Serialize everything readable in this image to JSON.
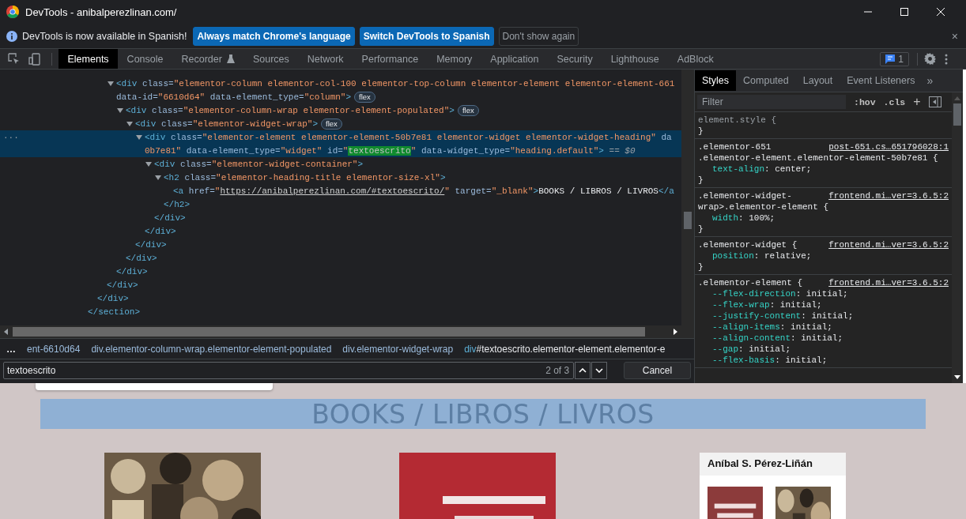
{
  "window": {
    "title": "DevTools - anibalperezlinan.com/"
  },
  "infobar": {
    "message": "DevTools is now available in Spanish!",
    "buttons": [
      {
        "label": "Always match Chrome's language",
        "kind": "primary"
      },
      {
        "label": "Switch DevTools to Spanish",
        "kind": "primary"
      },
      {
        "label": "Don't show again",
        "kind": "outline"
      }
    ],
    "close": "×"
  },
  "toolbar": {
    "tabs": [
      {
        "label": "Elements",
        "selected": true,
        "kind": "stable"
      },
      {
        "label": "Console",
        "selected": false,
        "kind": "stable"
      },
      {
        "label": "Recorder",
        "selected": false,
        "kind": "experimental"
      },
      {
        "label": "Sources",
        "selected": false,
        "kind": "stable"
      },
      {
        "label": "Network",
        "selected": false,
        "kind": "stable"
      },
      {
        "label": "Performance",
        "selected": false,
        "kind": "stable"
      },
      {
        "label": "Memory",
        "selected": false,
        "kind": "stable"
      },
      {
        "label": "Application",
        "selected": false,
        "kind": "stable"
      },
      {
        "label": "Security",
        "selected": false,
        "kind": "stable"
      },
      {
        "label": "Lighthouse",
        "selected": false,
        "kind": "stable"
      },
      {
        "label": "AdBlock",
        "selected": false,
        "kind": "stable"
      }
    ],
    "issues": "1"
  },
  "tree": [
    {
      "close": "</section>",
      "children": [
        {
          "close": "</div>",
          "children": [
            {
              "close": "</div>",
              "children": [
                {
                  "lines": [
                    [
                      {
                        "kind": "tag",
                        "text": "<div"
                      },
                      {
                        "kind": "attr",
                        "text": " class="
                      },
                      {
                        "kind": "value",
                        "text": "\"elementor-column elementor-col-100 elementor-top-column elementor-element elementor-element-661"
                      }
                    ],
                    [
                      {
                        "kind": "attr",
                        "text": "data-id="
                      },
                      {
                        "kind": "value",
                        "text": "\"6610d64\""
                      },
                      {
                        "kind": "attr",
                        "text": " data-element_type="
                      },
                      {
                        "kind": "value",
                        "text": "\"column\""
                      },
                      {
                        "kind": "tag",
                        "text": ">"
                      }
                    ]
                  ],
                  "badge": "flex",
                  "expanded": true,
                  "selected": false,
                  "close": "</div>",
                  "children": [
                    {
                      "lines": [
                        [
                          {
                            "kind": "tag",
                            "text": "<div"
                          },
                          {
                            "kind": "attr",
                            "text": " class="
                          },
                          {
                            "kind": "value",
                            "text": "\"elementor-column-wrap elementor-element-populated\""
                          },
                          {
                            "kind": "tag",
                            "text": ">"
                          }
                        ]
                      ],
                      "badge": "flex",
                      "expanded": true,
                      "selected": false,
                      "close": "</div>",
                      "children": [
                        {
                          "lines": [
                            [
                              {
                                "kind": "tag",
                                "text": "<div"
                              },
                              {
                                "kind": "attr",
                                "text": " class="
                              },
                              {
                                "kind": "value",
                                "text": "\"elementor-widget-wrap\""
                              },
                              {
                                "kind": "tag",
                                "text": ">"
                              }
                            ]
                          ],
                          "badge": "flex",
                          "expanded": true,
                          "selected": false,
                          "close": "</div>",
                          "children": [
                            {
                              "lines": [
                                [
                                  {
                                    "kind": "tag",
                                    "text": "<div"
                                  },
                                  {
                                    "kind": "attr",
                                    "text": " class="
                                  },
                                  {
                                    "kind": "value",
                                    "text": "\"elementor-element elementor-element-50b7e81 elementor-widget elementor-widget-heading\""
                                  },
                                  {
                                    "kind": "attr",
                                    "text": " da"
                                  }
                                ],
                                [
                                  {
                                    "kind": "value",
                                    "text": "0b7e81\""
                                  },
                                  {
                                    "kind": "attr",
                                    "text": " data-element_type="
                                  },
                                  {
                                    "kind": "value",
                                    "text": "\"widget\""
                                  },
                                  {
                                    "kind": "attr",
                                    "text": " id="
                                  },
                                  {
                                    "kind": "value",
                                    "text": "\""
                                  },
                                  {
                                    "kind": "match",
                                    "text": "textoescrito"
                                  },
                                  {
                                    "kind": "value",
                                    "text": "\""
                                  },
                                  {
                                    "kind": "attr",
                                    "text": " data-widget_type="
                                  },
                                  {
                                    "kind": "value",
                                    "text": "\"heading.default\""
                                  },
                                  {
                                    "kind": "tag",
                                    "text": ">"
                                  },
                                  {
                                    "kind": "meta",
                                    "text": " == $0"
                                  }
                                ]
                              ],
                              "dots": "···",
                              "expanded": true,
                              "selected": true,
                              "close": "</div>",
                              "children": [
                                {
                                  "lines": [
                                    [
                                      {
                                        "kind": "tag",
                                        "text": "<div"
                                      },
                                      {
                                        "kind": "attr",
                                        "text": " class="
                                      },
                                      {
                                        "kind": "value",
                                        "text": "\"elementor-widget-container\""
                                      },
                                      {
                                        "kind": "tag",
                                        "text": ">"
                                      }
                                    ]
                                  ],
                                  "expanded": true,
                                  "selected": false,
                                  "close": "</div>",
                                  "children": [
                                    {
                                      "lines": [
                                        [
                                          {
                                            "kind": "tag",
                                            "text": "<h2"
                                          },
                                          {
                                            "kind": "attr",
                                            "text": " class="
                                          },
                                          {
                                            "kind": "value",
                                            "text": "\"elementor-heading-title elementor-size-xl\""
                                          },
                                          {
                                            "kind": "tag",
                                            "text": ">"
                                          }
                                        ]
                                      ],
                                      "expanded": true,
                                      "selected": false,
                                      "close": "</h2>",
                                      "children": [
                                        {
                                          "lines": [
                                            [
                                              {
                                                "kind": "tag",
                                                "text": "<a"
                                              },
                                              {
                                                "kind": "attr",
                                                "text": " href="
                                              },
                                              {
                                                "kind": "value",
                                                "text": "\""
                                              },
                                              {
                                                "kind": "link",
                                                "text": "https://anibalperezlinan.com/#textoescrito/"
                                              },
                                              {
                                                "kind": "value",
                                                "text": "\""
                                              },
                                              {
                                                "kind": "attr",
                                                "text": " target="
                                              },
                                              {
                                                "kind": "value",
                                                "text": "\"_blank\""
                                              },
                                              {
                                                "kind": "tag",
                                                "text": ">"
                                              },
                                              {
                                                "kind": "text",
                                                "text": "BOOKS / LIBROS / LIVROS"
                                              },
                                              {
                                                "kind": "tag",
                                                "text": "</a"
                                              }
                                            ]
                                          ],
                                          "selected": false
                                        }
                                      ]
                                    }
                                  ]
                                }
                              ]
                            }
                          ]
                        }
                      ]
                    }
                  ]
                }
              ]
            }
          ]
        }
      ]
    }
  ],
  "breadcrumbs": {
    "more": "…",
    "items": [
      {
        "rest": "ent-6610d64",
        "selected": false
      },
      {
        "tag": "div",
        "rest": ".elementor-column-wrap.elementor-element-populated",
        "selected": false
      },
      {
        "tag": "div",
        "rest": ".elementor-widget-wrap",
        "selected": false
      },
      {
        "tag": "div",
        "rest": "#textoescrito.elementor-element.elementor-e",
        "selected": true
      }
    ]
  },
  "search": {
    "value": "textoescrito",
    "count": "2 of 3",
    "cancel": "Cancel"
  },
  "styles": {
    "tabs": [
      {
        "label": "Styles",
        "selected": true
      },
      {
        "label": "Computed",
        "selected": false
      },
      {
        "label": "Layout",
        "selected": false
      },
      {
        "label": "Event Listeners",
        "selected": false
      }
    ],
    "more": "»",
    "filter": {
      "placeholder": "Filter"
    },
    "hov": ":hov",
    "cls": ".cls",
    "add": "+",
    "rules": [
      {
        "kind": "inline",
        "selector": [
          "element.style {"
        ],
        "close": "}"
      },
      {
        "kind": "rule",
        "selector": [
          ".elementor-651",
          ".elementor-element.elementor-element-50b7e81 {"
        ],
        "source": "post-651.cs…651796028:1",
        "props": [
          {
            "name": "text-align",
            "value": ": center;"
          }
        ],
        "close": "}"
      },
      {
        "kind": "rule",
        "selector": [
          ".elementor-widget-",
          "wrap>.elementor-element {"
        ],
        "source": "frontend.mi…ver=3.6.5:2",
        "props": [
          {
            "name": "width",
            "value": ": 100%;"
          }
        ],
        "close": "}"
      },
      {
        "kind": "rule",
        "selector": [
          ".elementor-widget {"
        ],
        "source": "frontend.mi…ver=3.6.5:2",
        "props": [
          {
            "name": "position",
            "value": ": relative;"
          }
        ],
        "close": "}"
      },
      {
        "kind": "rule",
        "selector": [
          ".elementor-element {"
        ],
        "source": "frontend.mi…ver=3.6.5:2",
        "props": [
          {
            "name": "--flex-direction",
            "value": ": initial;"
          },
          {
            "name": "--flex-wrap",
            "value": ": initial;"
          },
          {
            "name": "--justify-content",
            "value": ": initial;"
          },
          {
            "name": "--align-items",
            "value": ": initial;"
          },
          {
            "name": "--align-content",
            "value": ": initial;"
          },
          {
            "name": "--gap",
            "value": ": initial;"
          },
          {
            "name": "--flex-basis",
            "value": ": initial;"
          }
        ]
      }
    ]
  },
  "page": {
    "heading": "BOOKS / LIBROS / LIVROS",
    "books": [
      {
        "kind": "picture"
      },
      {
        "kind": "picture"
      },
      {
        "kind": "card",
        "title": "Aníbal S. Pérez-Liñán"
      }
    ]
  }
}
